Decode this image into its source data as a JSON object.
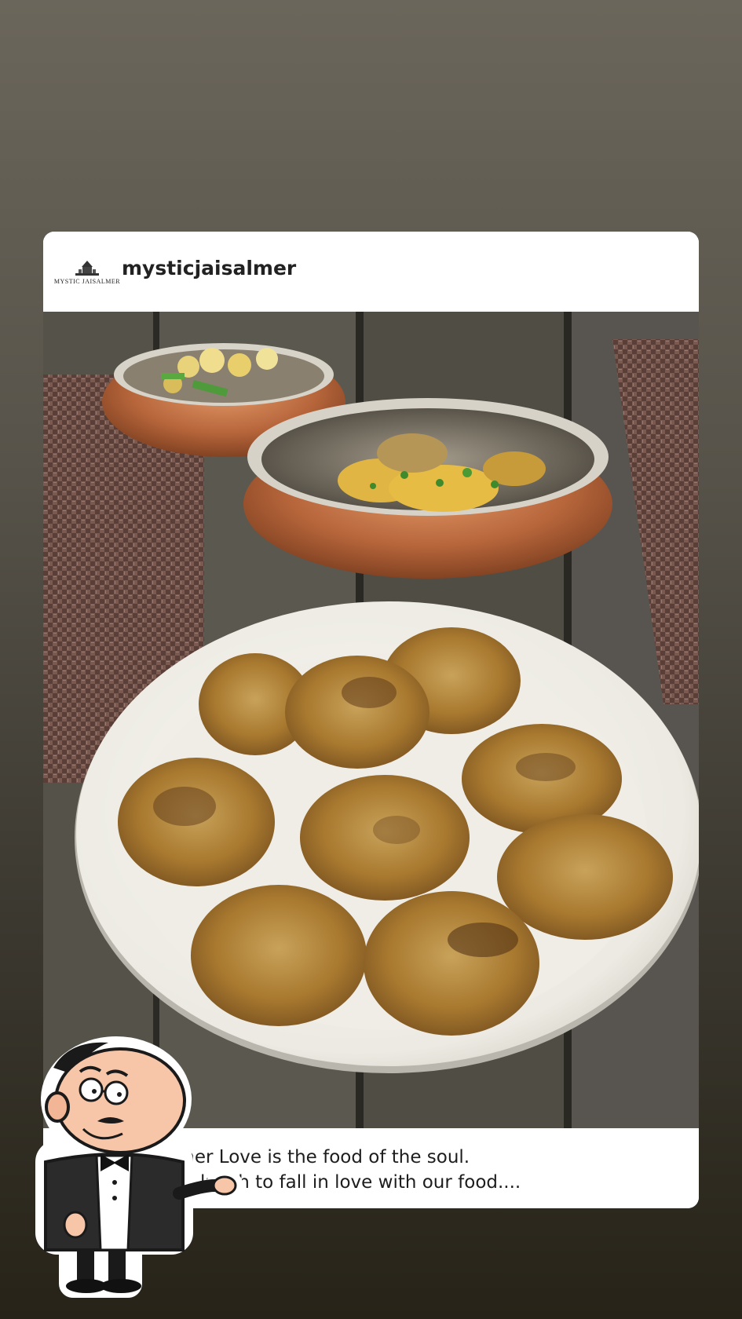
{
  "post": {
    "logo_text": "MYSTIC JAISALMER",
    "username": "mysticjaisalmer",
    "caption": {
      "line1": "almer Love is the food of the soul.",
      "line2": "noa lunch to fall in love with our food...."
    }
  },
  "colors": {
    "background_top": "#6b665b",
    "background_bottom": "#272318",
    "card": "#ffffff"
  },
  "icons": {
    "mascot": "waiter-mascot-icon",
    "logo": "palace-logo-icon"
  }
}
